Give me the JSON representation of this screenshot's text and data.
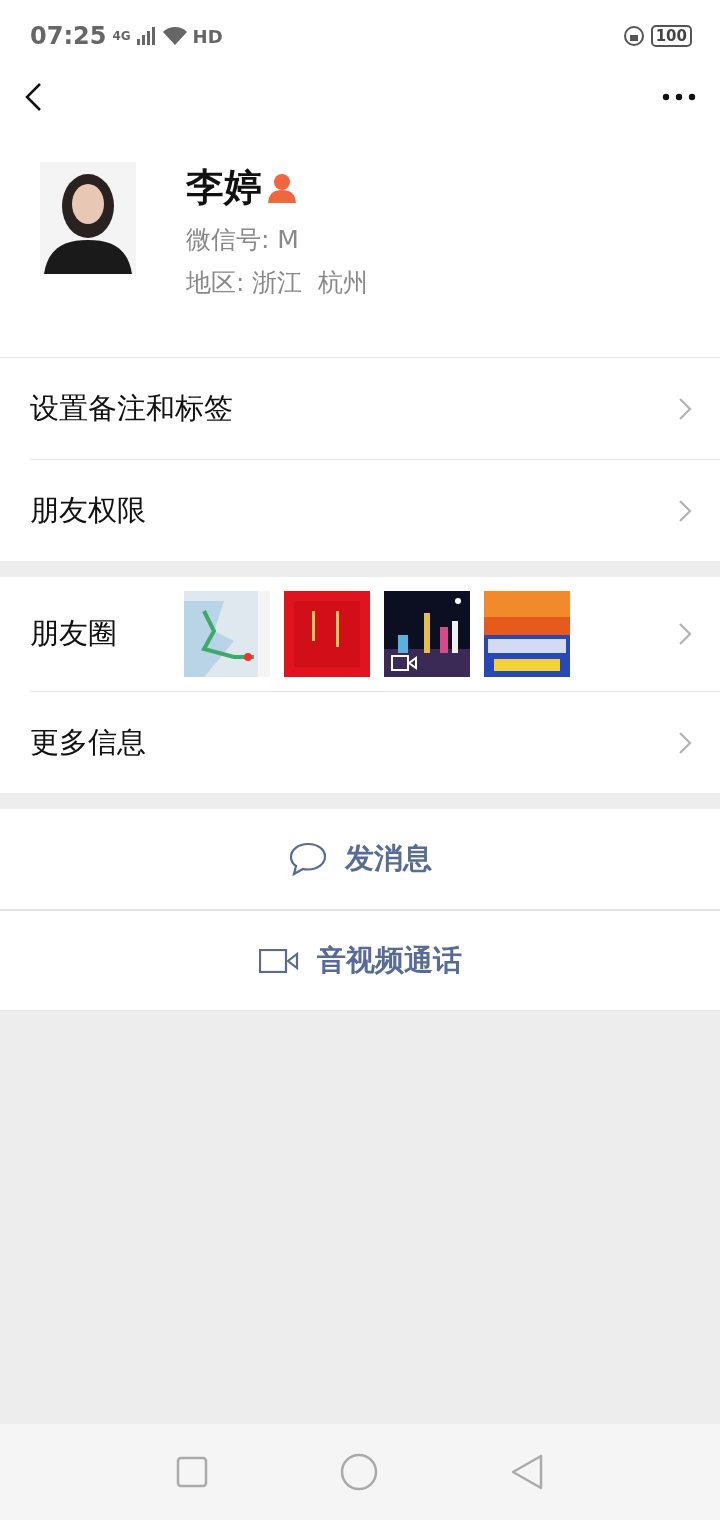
{
  "status_bar": {
    "time": "07:25",
    "network": "4G",
    "hd": "HD",
    "battery": "100"
  },
  "profile": {
    "name": "李婷",
    "wechat_id": "微信号: M",
    "region": "地区: 浙江  杭州"
  },
  "settings_rows": [
    {
      "label": "设置备注和标签"
    },
    {
      "label": "朋友权限"
    }
  ],
  "info_rows": [
    {
      "label": "朋友圈",
      "kind": "moments",
      "thumbnails": [
        {
          "kind": "picture",
          "video": false
        },
        {
          "kind": "picture",
          "video": false
        },
        {
          "kind": "picture",
          "video": true
        },
        {
          "kind": "picture",
          "video": false
        }
      ]
    },
    {
      "label": "更多信息",
      "kind": "plain"
    }
  ],
  "actions": [
    {
      "label": "发消息",
      "kind": "message"
    },
    {
      "label": "音视频通话",
      "kind": "call"
    }
  ]
}
